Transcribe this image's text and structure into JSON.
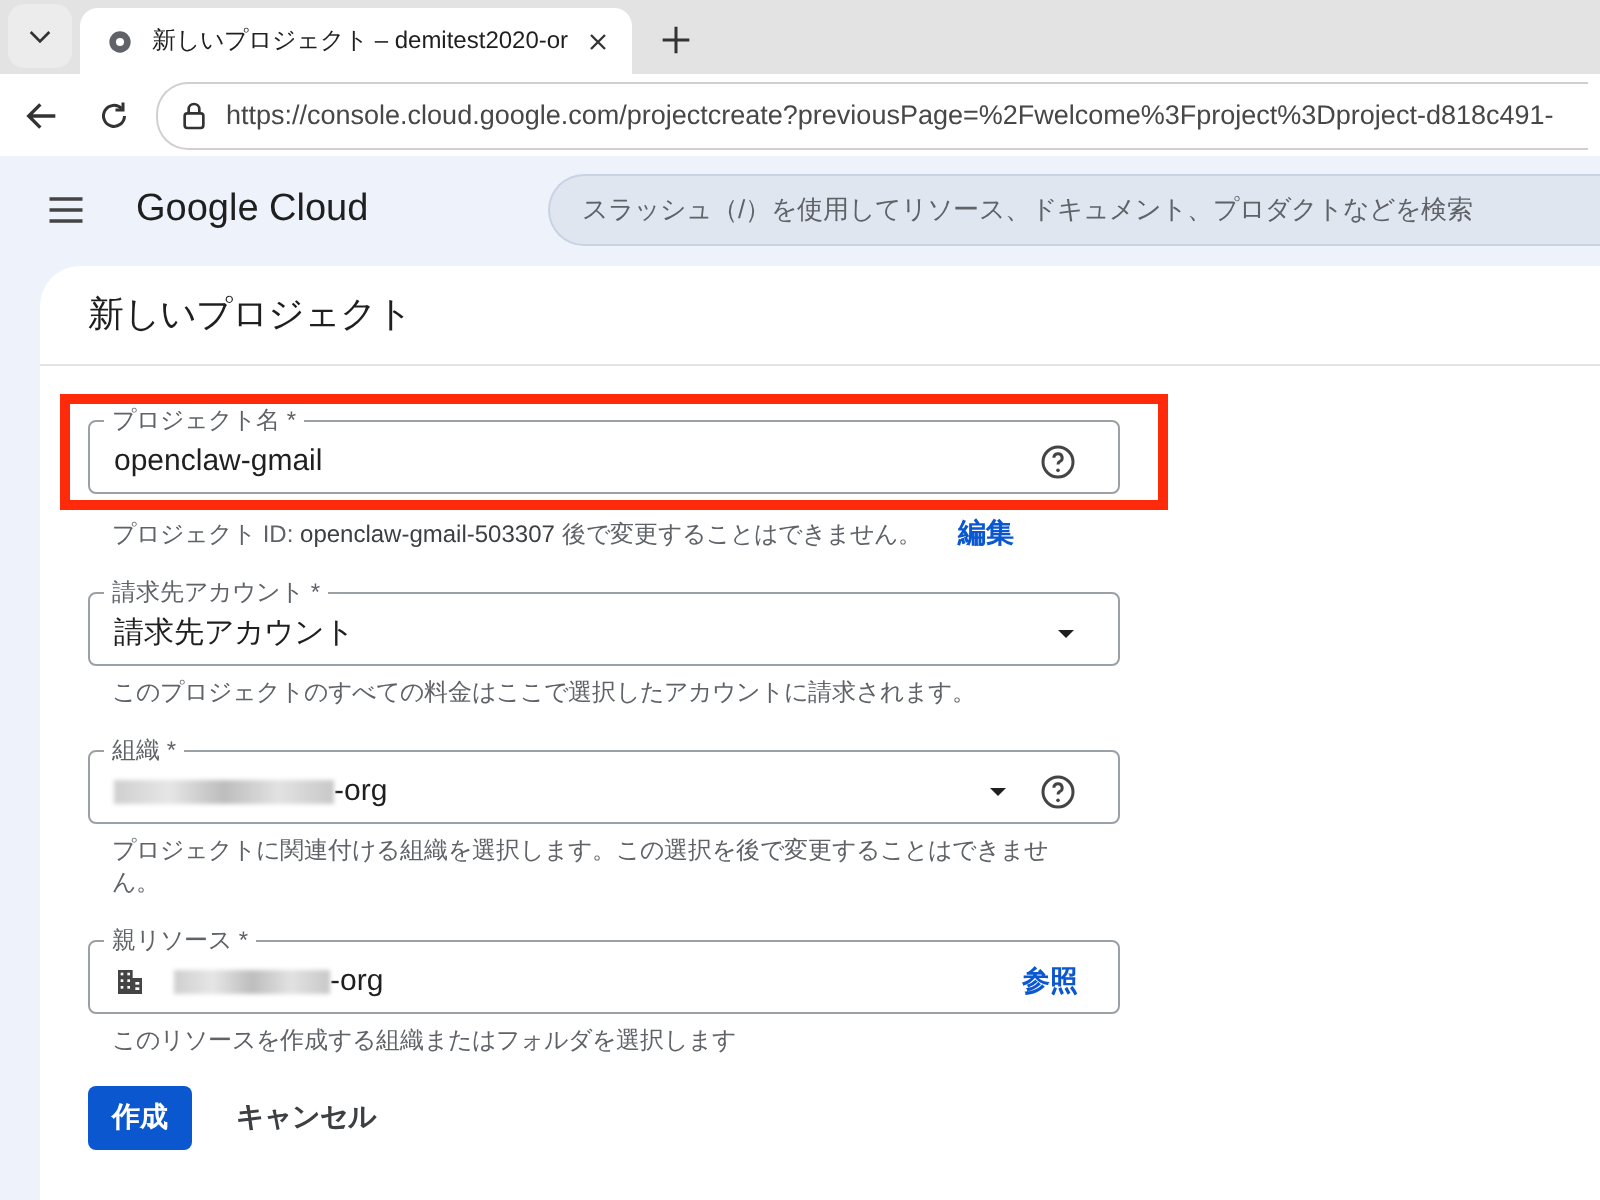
{
  "browser": {
    "tab": {
      "title": "新しいプロジェクト – demitest2020-or",
      "selected": true
    },
    "url": "https://console.cloud.google.com/projectcreate?previousPage=%2Fwelcome%3Fproject%3Dproject-d818c491-"
  },
  "header": {
    "logo": "Google Cloud",
    "search": {
      "placeholder": "スラッシュ（/）を使用してリソース、ドキュメント、プロダクトなどを検索"
    }
  },
  "page": {
    "title": "新しいプロジェクト"
  },
  "fields": [
    {
      "kind": "text",
      "label": "プロジェクト名 *",
      "value": "openclaw-gmail",
      "help_icon": true,
      "highlighted": true,
      "hint": "プロジェクト ID: **openclaw-gmail-503307** 後で変更することはできません。",
      "hint_link": "編集"
    },
    {
      "kind": "select",
      "label": "請求先アカウント *",
      "value": "請求先アカウント",
      "help_icon": false,
      "highlighted": false,
      "hint": "このプロジェクトのすべての料金はここで選択したアカウントに請求されます。"
    },
    {
      "kind": "select",
      "label": "組織 *",
      "value": "-org",
      "redacted": true,
      "help_icon": true,
      "highlighted": false,
      "hint": "プロジェクトに関連付ける組織を選択します。この選択を後で変更することはできません。"
    },
    {
      "kind": "resource",
      "label": "親リソース *",
      "value": "-org",
      "redacted": true,
      "help_icon": false,
      "highlighted": false,
      "action": "参照",
      "hint": "このリソースを作成する組織またはフォルダを選択します"
    }
  ],
  "buttons": [
    {
      "label": "作成",
      "kind": "primary"
    },
    {
      "label": "キャンセル",
      "kind": "text"
    }
  ]
}
